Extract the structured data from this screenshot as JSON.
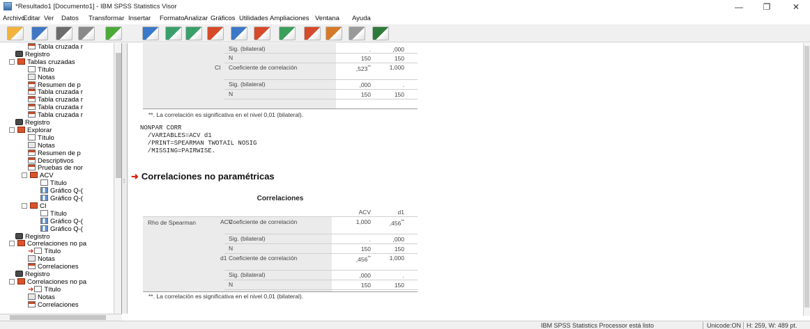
{
  "window": {
    "title": "*Resultado1 [Documento1] - IBM SPSS Statistics Visor",
    "minimize": "—",
    "restore": "❐",
    "close": "✕"
  },
  "menu": [
    "Archivo",
    "Editar",
    "Ver",
    "Datos",
    "Transformar",
    "Insertar",
    "Formato",
    "Analizar",
    "Gráficos",
    "Utilidades",
    "Ampliaciones",
    "Ventana",
    "Ayuda"
  ],
  "toolbar_icons": [
    "open-icon",
    "save-icon",
    "print-icon",
    "print-preview-icon",
    "export-icon",
    "recall-dialog-icon",
    "undo-icon",
    "redo-icon",
    "goto-data-icon",
    "goto-case-icon",
    "goto-variable-icon",
    "variables-icon",
    "show-output-icon",
    "hide-output-icon",
    "promote-icon",
    "designate-window-icon"
  ],
  "tree": [
    {
      "label": "Tabla cruzada r",
      "icon": "table",
      "indent": 4
    },
    {
      "label": "Registro",
      "icon": "log",
      "indent": 2
    },
    {
      "label": "Tablas cruzadas",
      "icon": "book",
      "indent": 1,
      "exp": "−"
    },
    {
      "label": "Título",
      "icon": "title",
      "indent": 4
    },
    {
      "label": "Notas",
      "icon": "notes",
      "indent": 4
    },
    {
      "label": "Resumen de p",
      "icon": "table",
      "indent": 4
    },
    {
      "label": "Tabla cruzada r",
      "icon": "table",
      "indent": 4
    },
    {
      "label": "Tabla cruzada r",
      "icon": "table",
      "indent": 4
    },
    {
      "label": "Tabla cruzada r",
      "icon": "table",
      "indent": 4
    },
    {
      "label": "Tabla cruzada r",
      "icon": "table",
      "indent": 4
    },
    {
      "label": "Registro",
      "icon": "log",
      "indent": 2
    },
    {
      "label": "Explorar",
      "icon": "book",
      "indent": 1,
      "exp": "−"
    },
    {
      "label": "Título",
      "icon": "title",
      "indent": 4
    },
    {
      "label": "Notas",
      "icon": "notes",
      "indent": 4
    },
    {
      "label": "Resumen de p",
      "icon": "table",
      "indent": 4
    },
    {
      "label": "Descriptivos",
      "icon": "table",
      "indent": 4
    },
    {
      "label": "Pruebas de nor",
      "icon": "table",
      "indent": 4
    },
    {
      "label": "ACV",
      "icon": "book",
      "indent": 3,
      "exp": "−"
    },
    {
      "label": "Título",
      "icon": "title",
      "indent": 6
    },
    {
      "label": "Gráfico Q-(",
      "icon": "chart",
      "indent": 6
    },
    {
      "label": "Gráfico Q-(",
      "icon": "chart",
      "indent": 6
    },
    {
      "label": "CI",
      "icon": "book",
      "indent": 3,
      "exp": "−"
    },
    {
      "label": "Título",
      "icon": "title",
      "indent": 6
    },
    {
      "label": "Gráfico Q-(",
      "icon": "chart",
      "indent": 6
    },
    {
      "label": "Gráfico Q-(",
      "icon": "chart",
      "indent": 6
    },
    {
      "label": "Registro",
      "icon": "log",
      "indent": 2
    },
    {
      "label": "Correlaciones no pa",
      "icon": "book",
      "indent": 1,
      "exp": "−"
    },
    {
      "label": "Título",
      "icon": "title",
      "indent": 4,
      "arrow": true
    },
    {
      "label": "Notas",
      "icon": "notes",
      "indent": 4
    },
    {
      "label": "Correlaciones",
      "icon": "table",
      "indent": 4
    },
    {
      "label": "Registro",
      "icon": "log",
      "indent": 2
    },
    {
      "label": "Correlaciones no pa",
      "icon": "book",
      "indent": 1,
      "exp": "−"
    },
    {
      "label": "Título",
      "icon": "title",
      "indent": 4,
      "arrow": true
    },
    {
      "label": "Notas",
      "icon": "notes",
      "indent": 4
    },
    {
      "label": "Correlaciones",
      "icon": "table",
      "indent": 4
    }
  ],
  "table1": {
    "rows": [
      {
        "var": "",
        "stat": "Sig. (bilateral)",
        "v1": ".",
        "v2": ",000"
      },
      {
        "var": "",
        "stat": "N",
        "v1": "150",
        "v2": "150"
      },
      {
        "var": "CI",
        "stat": "Coeficiente de correlación",
        "v1": ",523",
        "v1sup": "**",
        "v2": "1,000"
      },
      {
        "var": "",
        "stat": "Sig. (bilateral)",
        "v1": ",000",
        "v2": "."
      },
      {
        "var": "",
        "stat": "N",
        "v1": "150",
        "v2": "150"
      }
    ],
    "footnote": "**. La correlación es significativa en el nivel 0,01 (bilateral)."
  },
  "syntax": "NONPAR CORR\n  /VARIABLES=ACV d1\n  /PRINT=SPEARMAN TWOTAIL NOSIG\n  /MISSING=PAIRWISE.",
  "section_title": "Correlaciones no paramétricas",
  "table2": {
    "title": "Correlaciones",
    "col_headers": [
      "ACV",
      "d1"
    ],
    "row_group": "Rho de Spearman",
    "rows": [
      {
        "var": "ACV",
        "stat": "Coeficiente de correlación",
        "v1": "1,000",
        "v2": ",456",
        "v2sup": "**"
      },
      {
        "var": "",
        "stat": "Sig. (bilateral)",
        "v1": ".",
        "v2": ",000"
      },
      {
        "var": "",
        "stat": "N",
        "v1": "150",
        "v2": "150"
      },
      {
        "var": "d1",
        "stat": "Coeficiente de correlación",
        "v1": ",456",
        "v1sup": "**",
        "v2": "1,000"
      },
      {
        "var": "",
        "stat": "Sig. (bilateral)",
        "v1": ",000",
        "v2": "."
      },
      {
        "var": "",
        "stat": "N",
        "v1": "150",
        "v2": "150"
      }
    ],
    "footnote": "**. La correlación es significativa en el nivel 0,01 (bilateral)."
  },
  "status": {
    "processor": "IBM SPSS Statistics Processor está listo",
    "unicode": "Unicode:ON",
    "size": "H: 259, W: 489 pt."
  }
}
